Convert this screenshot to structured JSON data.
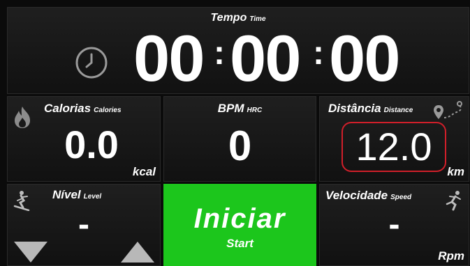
{
  "time": {
    "label": "Tempo",
    "sublabel": "Time",
    "hours": "00",
    "minutes": "00",
    "seconds": "00",
    "separator": ":"
  },
  "calories": {
    "label": "Calorias",
    "sublabel": "Calories",
    "value": "0.0",
    "unit": "kcal"
  },
  "bpm": {
    "label": "BPM",
    "sublabel": "HRC",
    "value": "0"
  },
  "distance": {
    "label": "Distância",
    "sublabel": "Distance",
    "value": "12.0",
    "unit": "km",
    "highlight_color": "#d11f2a"
  },
  "level": {
    "label": "Nível",
    "sublabel": "Level",
    "value": "-"
  },
  "start": {
    "label": "Iniciar",
    "sublabel": "Start",
    "color": "#1cc61c"
  },
  "speed": {
    "label": "Velocidade",
    "sublabel": "Speed",
    "value": "-",
    "unit": "Rpm"
  },
  "icons": [
    "clock-icon",
    "flame-icon",
    "map-route-icon",
    "skier-icon",
    "runner-icon",
    "decrease-triangle-icon",
    "increase-triangle-icon"
  ]
}
